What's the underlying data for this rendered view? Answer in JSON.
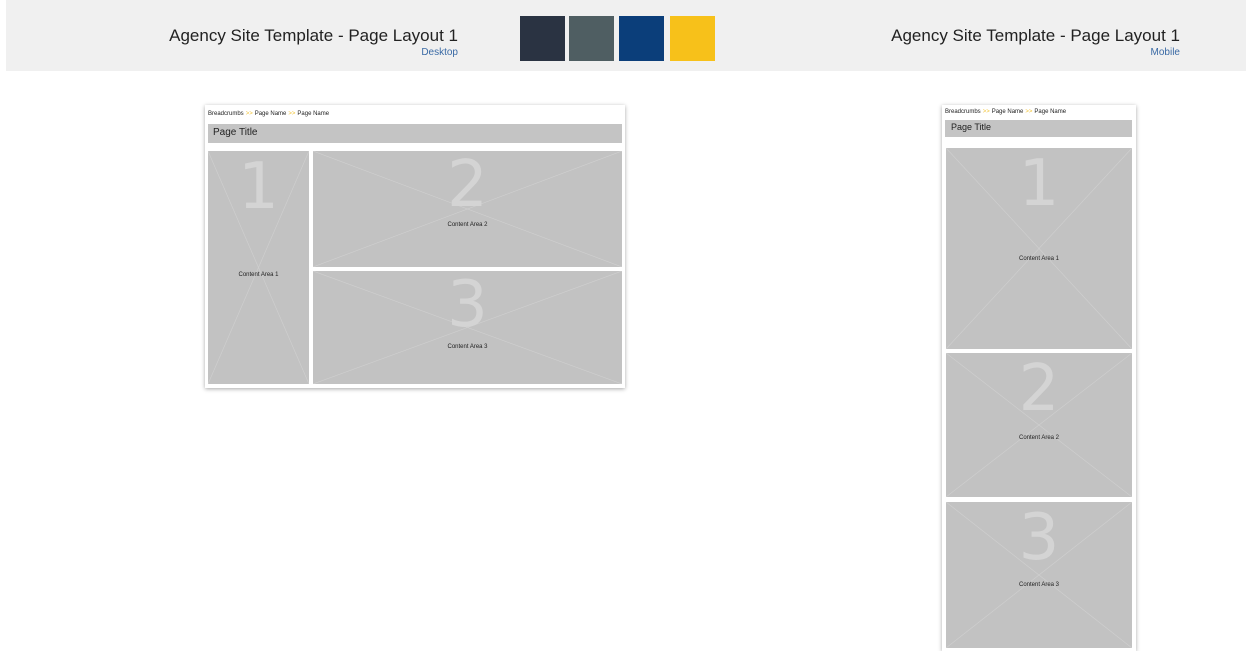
{
  "header": {
    "desktop_title": "Agency Site Template - Page Layout 1",
    "desktop_subtitle": "Desktop",
    "mobile_title": "Agency Site Template  - Page Layout 1",
    "mobile_subtitle": "Mobile",
    "swatches": [
      "#2a3342",
      "#4f5e62",
      "#0b3e7a",
      "#f7c11a"
    ]
  },
  "breadcrumbs": {
    "root": "Breadcrumbs",
    "separator": ">>",
    "item1": "Page Name",
    "item2": "Page Name"
  },
  "page_title": "Page Title",
  "areas": [
    {
      "number": "1",
      "label": "Content Area 1"
    },
    {
      "number": "2",
      "label": "Content Area 2"
    },
    {
      "number": "3",
      "label": "Content Area 3"
    }
  ]
}
